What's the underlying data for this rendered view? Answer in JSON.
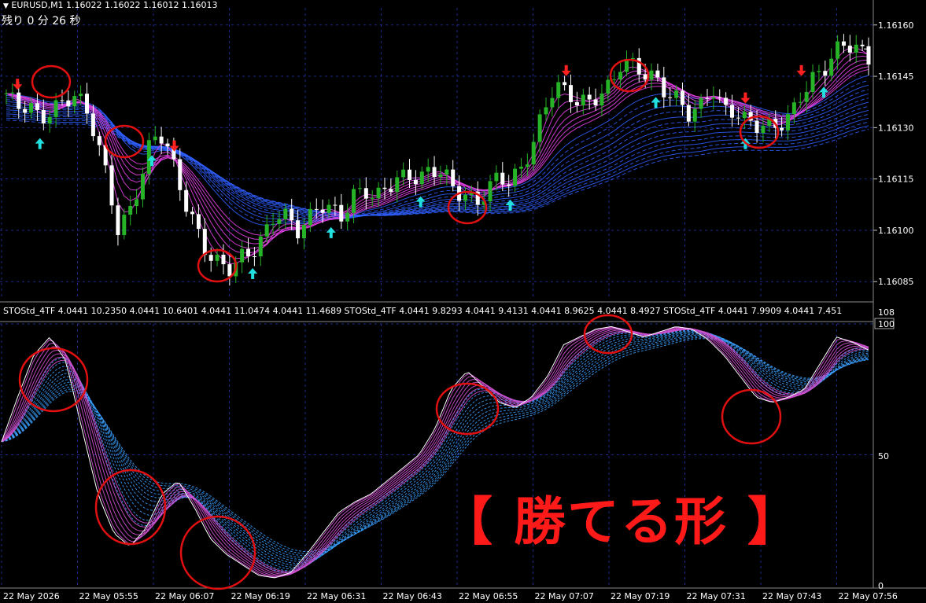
{
  "header": {
    "symbol_line": "EURUSD,M1  1.16022 1.16022 1.16012 1.16013",
    "countdown": "残り 0 分 26 秒"
  },
  "indicator": {
    "label": "STOStd_4TF 4.0441 10.2350 4.0441 10.6401 4.0441 11.0474 4.0441 11.4689  STOStd_4TF 4.0441 9.8293 4.0441 9.4131 4.0441 8.9625 4.0441 8.4927  STOStd_4TF 4.0441 7.9909 4.0441 7.451"
  },
  "overlay_text": "【 勝てる形 】",
  "colors": {
    "background": "#000000",
    "grid": "#1e2a8a",
    "bull": "#27b327",
    "bear": "#ffffff",
    "ribbon_fast": "#e040e0",
    "ribbon_slow": "#2f5fff",
    "sto_fast": "#d050d0",
    "sto_slow": "#3aa0ff",
    "buy_arrow": "#22e0e0",
    "sell_arrow": "#ff2020",
    "circle": "#e01010",
    "overlay_text": "#ff1a1a"
  },
  "chart_data": [
    {
      "type": "candlestick",
      "title": "EURUSD,M1",
      "ylim": [
        1.1608,
        1.16165
      ],
      "y_ticks": [
        "1.16160",
        "1.16145",
        "1.16130",
        "1.16115",
        "1.16100",
        "1.16085"
      ],
      "price_path": [
        1.1614,
        1.16136,
        1.16137,
        1.16132,
        1.16135,
        1.16137,
        1.1614,
        1.16136,
        1.16128,
        1.16115,
        1.161,
        1.16105,
        1.16115,
        1.16127,
        1.16128,
        1.16118,
        1.16108,
        1.161,
        1.16093,
        1.1609,
        1.16089,
        1.16092,
        1.16094,
        1.16098,
        1.16105,
        1.16104,
        1.161,
        1.16103,
        1.16108,
        1.16106,
        1.16104,
        1.1611,
        1.16112,
        1.16109,
        1.16113,
        1.16115,
        1.16116,
        1.16115,
        1.16118,
        1.16117,
        1.16112,
        1.1611,
        1.16108,
        1.16112,
        1.16116,
        1.16114,
        1.16118,
        1.16125,
        1.16135,
        1.16143,
        1.1614,
        1.16138,
        1.16137,
        1.1614,
        1.16142,
        1.1615,
        1.16148,
        1.16146,
        1.16144,
        1.1614,
        1.16138,
        1.16134,
        1.16136,
        1.16142,
        1.16135,
        1.16135,
        1.16132,
        1.16131,
        1.1613,
        1.16131,
        1.16133,
        1.1614,
        1.16144,
        1.16147,
        1.16152,
        1.16155,
        1.16153,
        1.1615
      ],
      "sell_signal_index": [
        1,
        15,
        50,
        66,
        71
      ],
      "buy_signal_index": [
        3,
        13,
        22,
        29,
        37,
        45,
        58,
        66,
        73
      ],
      "circled_index": [
        5,
        12,
        22,
        47,
        63,
        75
      ]
    },
    {
      "type": "line",
      "title": "STOStd_4TF",
      "ylim": [
        0,
        108
      ],
      "y_ticks": [
        "108",
        "100",
        "50",
        "0"
      ],
      "series": [
        {
          "values": [
            55,
            72,
            88,
            95,
            86,
            60,
            35,
            20,
            15,
            22,
            35,
            40,
            30,
            18,
            12,
            8,
            4,
            3,
            5,
            12,
            20,
            28,
            32,
            35,
            40,
            45,
            50,
            60,
            75,
            82,
            76,
            70,
            68,
            72,
            80,
            92,
            95,
            98,
            99,
            97,
            95,
            97,
            99,
            98,
            94,
            88,
            80,
            72,
            70,
            72,
            75,
            85,
            95,
            93,
            90
          ]
        }
      ]
    }
  ],
  "x_axis": {
    "labels": [
      "22 May 2026",
      "22 May 05:55",
      "22 May 06:07",
      "22 May 06:19",
      "22 May 06:31",
      "22 May 06:43",
      "22 May 06:55",
      "22 May 07:07",
      "22 May 07:19",
      "22 May 07:31",
      "22 May 07:43",
      "22 May 07:56"
    ]
  }
}
